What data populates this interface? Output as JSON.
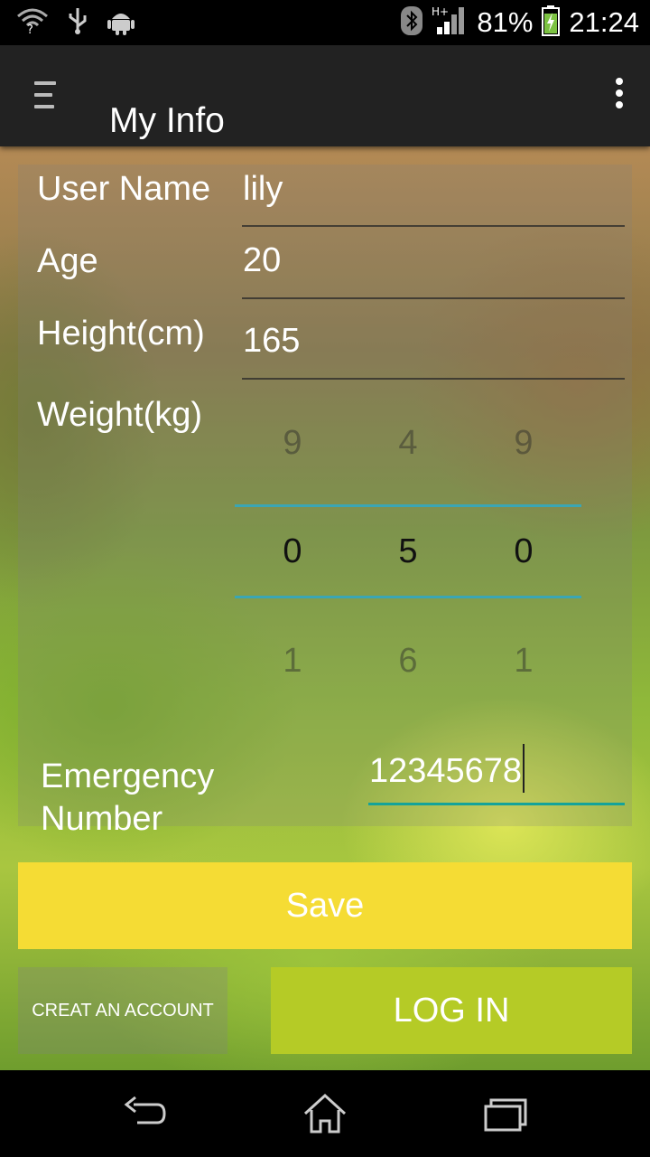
{
  "status_bar": {
    "battery_percent": "81%",
    "time": "21:24",
    "network_type": "H+",
    "icons": [
      "wifi-question-icon",
      "usb-icon",
      "android-icon",
      "bluetooth-icon",
      "signal-icon",
      "battery-charging-icon"
    ]
  },
  "action_bar": {
    "title": "My Info",
    "menu_icon": "hamburger-icon",
    "overflow_icon": "more-vert-icon"
  },
  "form": {
    "user_name": {
      "label": "User Name",
      "value": "lily"
    },
    "age": {
      "label": "Age",
      "value": "20"
    },
    "height": {
      "label": "Height(cm)",
      "value": "165"
    },
    "weight": {
      "label": "Weight(kg)",
      "picker": {
        "above": [
          "9",
          "4",
          "9"
        ],
        "selected": [
          "0",
          "5",
          "0"
        ],
        "below": [
          "1",
          "6",
          "1"
        ]
      }
    },
    "emergency": {
      "label_line1": "Emergency",
      "label_line2": "Number",
      "value": "12345678"
    }
  },
  "buttons": {
    "save": "Save",
    "create_account": "CREAT AN ACCOUNT",
    "login": "LOG IN"
  },
  "nav_bar": {
    "icons": [
      "back-icon",
      "home-icon",
      "recents-icon"
    ]
  },
  "colors": {
    "save_button": "#f5dc34",
    "login_button": "#b5cb26",
    "picker_divider": "#3aa6b4",
    "input_focus": "#14a39a"
  }
}
